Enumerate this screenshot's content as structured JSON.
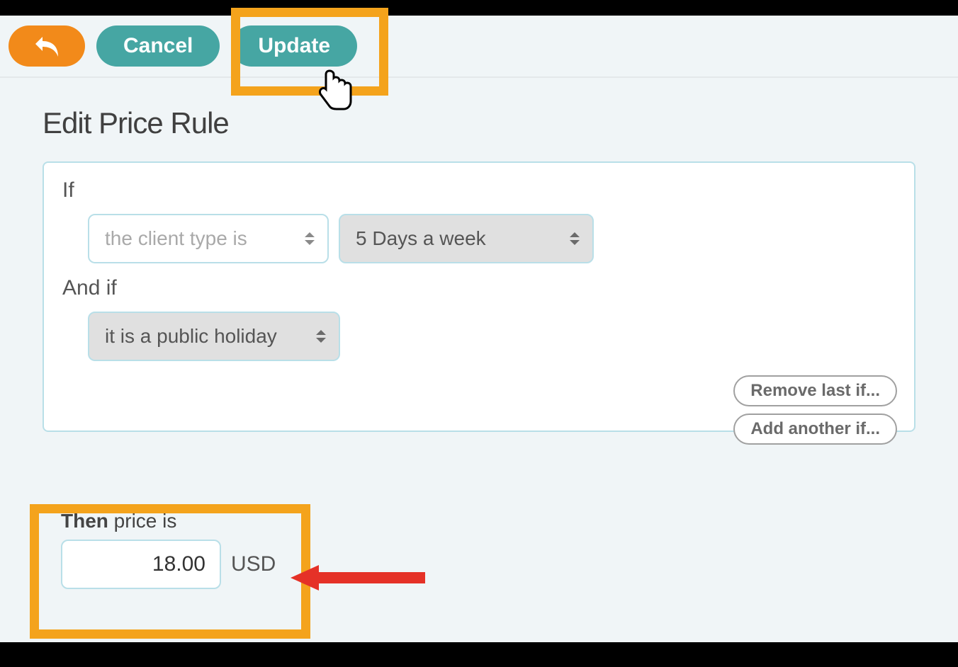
{
  "header": {
    "cancel_label": "Cancel",
    "update_label": "Update"
  },
  "page": {
    "title": "Edit Price Rule"
  },
  "rule": {
    "if_label": "If",
    "andif_label": "And if",
    "condition1_type": "the client type is",
    "condition1_value": "5 Days a week",
    "condition2_value": "it is a public holiday",
    "remove_label": "Remove last if...",
    "add_label": "Add another if..."
  },
  "then": {
    "bold": "Then",
    "rest": " price is",
    "price_value": "18.00",
    "currency": "USD"
  }
}
